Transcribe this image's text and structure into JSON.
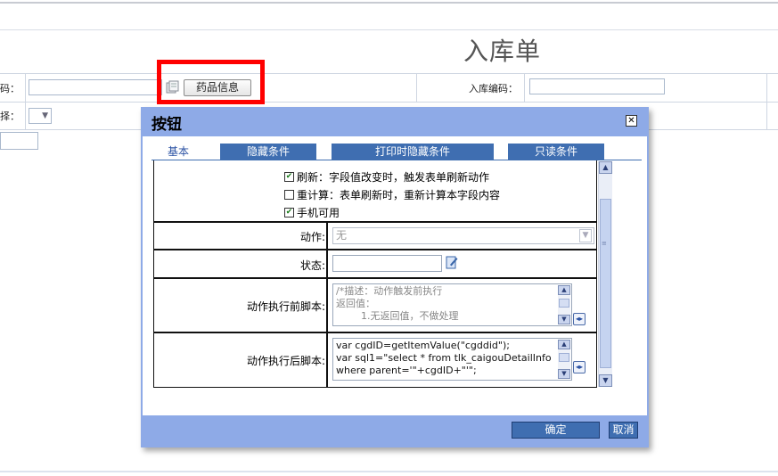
{
  "form": {
    "title": "入库单",
    "row1": {
      "left_label": "码：",
      "drug_info_button": "药品信息",
      "entry_code_label": "入库编码："
    },
    "row2": {
      "left_label": "择："
    }
  },
  "dialog": {
    "title": "按钮",
    "close_icon": "close-icon",
    "tabs": [
      "基本",
      "隐藏条件",
      "打印时隐藏条件",
      "只读条件"
    ],
    "checkboxes": [
      {
        "label": "刷新：字段值改变时，触发表单刷新动作",
        "checked": true
      },
      {
        "label": "重计算：表单刷新时，重新计算本字段内容",
        "checked": false
      },
      {
        "label": "手机可用",
        "checked": true
      }
    ],
    "fields": {
      "action": {
        "label": "动作:",
        "value": "无"
      },
      "status": {
        "label": "状态:",
        "value": ""
      },
      "before_script": {
        "label": "动作执行前脚本:",
        "lines": [
          "/*描述：动作触发前执行",
          "返回值：",
          "        1.无返回值，不做处理"
        ]
      },
      "after_script": {
        "label": "动作执行后脚本:",
        "lines": [
          "var cgdID=getItemValue(\"cgddid\");",
          "var sql1=\"select * from tlk_caigouDetailInfo",
          "where parent='\"+cgdID+\"'\";"
        ]
      }
    },
    "buttons": {
      "ok": "确定",
      "cancel": "取消"
    }
  },
  "colors": {
    "tab_blue": "#3f6eb1",
    "dialog_frame": "#8eaae7",
    "highlight": "#ff0000"
  }
}
